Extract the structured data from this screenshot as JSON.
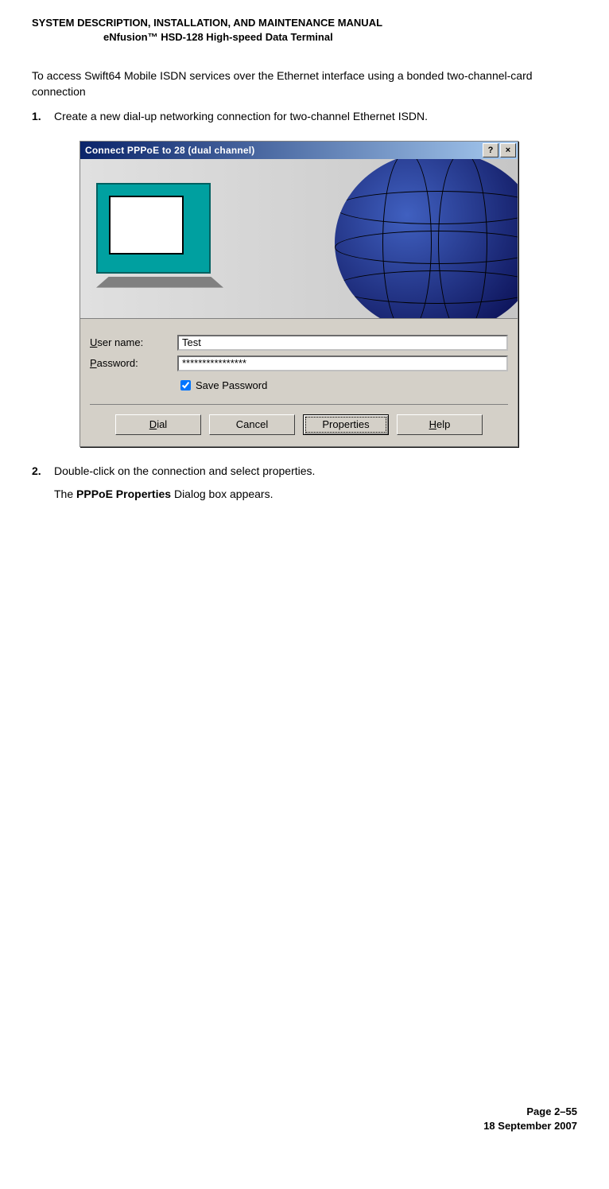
{
  "doc": {
    "header_line1": "SYSTEM DESCRIPTION, INSTALLATION, AND MAINTENANCE MANUAL",
    "header_line2": "eNfusion™ HSD-128 High-speed Data Terminal",
    "intro": "To access Swift64 Mobile ISDN services over the Ethernet interface using a bonded two-channel-card connection",
    "step1_num": "1.",
    "step1_text": "Create a new dial-up networking connection for two-channel  Ethernet ISDN.",
    "step2_num": "2.",
    "step2_text": "Double-click on the connection and select properties.",
    "result_prefix": "The ",
    "result_bold": "PPPoE Properties",
    "result_suffix": " Dialog box appears.",
    "page_label": "Page 2–55",
    "date": "18 September 2007"
  },
  "dialog": {
    "title": "Connect PPPoE to 28 (dual channel)",
    "help_glyph": "?",
    "close_glyph": "×",
    "username_label_u": "U",
    "username_label_rest": "ser name:",
    "password_label_p": "P",
    "password_label_rest": "assword:",
    "username_value": "Test",
    "password_value": "****************",
    "save_pw_s": "S",
    "save_pw_rest": "ave Password",
    "btn_dial_d": "D",
    "btn_dial_rest": "ial",
    "btn_cancel": "Cancel",
    "btn_properties": "Properties",
    "btn_help_h": "H",
    "btn_help_rest": "elp"
  }
}
